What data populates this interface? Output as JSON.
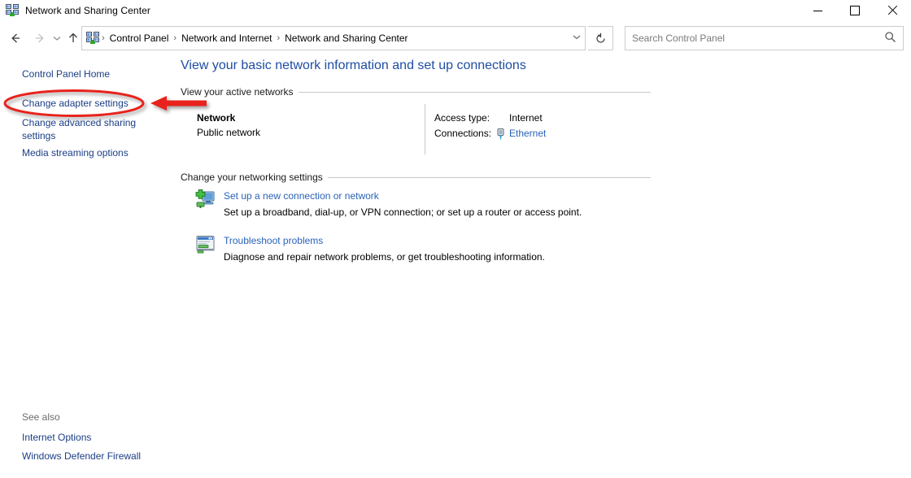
{
  "window": {
    "title": "Network and Sharing Center",
    "icon": "network-sharing-icon",
    "minimize_label": "Minimize",
    "maximize_label": "Maximize",
    "close_label": "Close"
  },
  "toolbar": {
    "back_label": "Back",
    "forward_label": "Forward",
    "recent_label": "Recent locations",
    "up_label": "Up",
    "refresh_label": "Refresh",
    "breadcrumb": [
      "Control Panel",
      "Network and Internet",
      "Network and Sharing Center"
    ],
    "breadcrumb_separator": "›",
    "breadcrumb_dropdown": "⌄"
  },
  "search": {
    "placeholder": "Search Control Panel",
    "value": "",
    "icon": "search-icon"
  },
  "sidebar": {
    "items": [
      {
        "label": "Control Panel Home"
      },
      {
        "label": "Change adapter settings"
      },
      {
        "label": "Change advanced sharing"
      },
      {
        "label": "settings"
      },
      {
        "label": "Media streaming options"
      }
    ],
    "see_also_label": "See also",
    "see_also_items": [
      {
        "label": "Internet Options"
      },
      {
        "label": "Windows Defender Firewall"
      }
    ]
  },
  "main": {
    "heading": "View your basic network information and set up connections",
    "active_networks_label": "View your active networks",
    "network": {
      "name": "Network",
      "type": "Public network",
      "access_type_label": "Access type:",
      "access_type_value": "Internet",
      "connections_label": "Connections:",
      "connection_name": "Ethernet",
      "connection_icon": "ethernet-icon"
    },
    "change_settings_label": "Change your networking settings",
    "tasks": [
      {
        "icon": "new-connection-icon",
        "link": "Set up a new connection or network",
        "description": "Set up a broadband, dial-up, or VPN connection; or set up a router or access point."
      },
      {
        "icon": "troubleshoot-icon",
        "link": "Troubleshoot problems",
        "description": "Diagnose and repair network problems, or get troubleshooting information."
      }
    ]
  },
  "annotation": {
    "color": "#e8201a",
    "shape": "ellipse-and-arrow",
    "target": "Change adapter settings"
  },
  "colors": {
    "heading_blue": "#1f4da1",
    "link_blue": "#2a63b8",
    "sidebar_link": "#1b3e85",
    "annotation_red": "#e8201a",
    "rule_grey": "#c8c8c8"
  }
}
